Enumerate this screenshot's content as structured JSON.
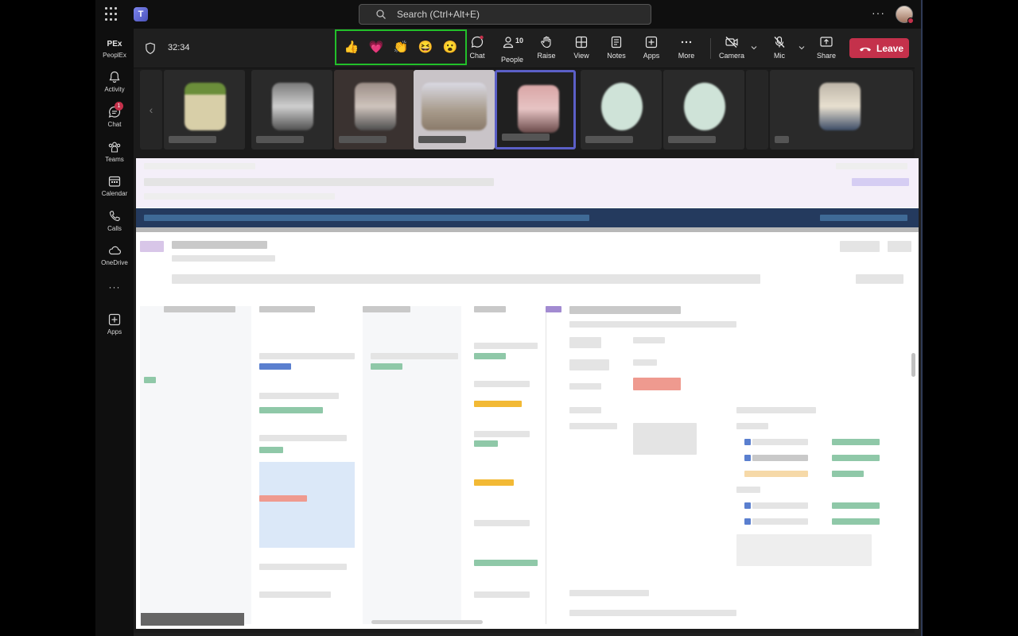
{
  "topbar": {
    "search_placeholder": "Search (Ctrl+Alt+E)",
    "more_label": "···"
  },
  "rail": {
    "org_label": "PEx",
    "items": [
      {
        "label": "PeoplEx"
      },
      {
        "label": "Activity"
      },
      {
        "label": "Chat",
        "badge": "1"
      },
      {
        "label": "Teams"
      },
      {
        "label": "Calendar"
      },
      {
        "label": "Calls"
      },
      {
        "label": "OneDrive"
      },
      {
        "label": "···"
      },
      {
        "label": "Apps"
      }
    ]
  },
  "meeting": {
    "timer": "32:34",
    "reactions": [
      "👍",
      "💗",
      "👏",
      "😆",
      "😮"
    ],
    "controls": {
      "chat": "Chat",
      "people": "People",
      "people_count": "10",
      "raise": "Raise",
      "view": "View",
      "notes": "Notes",
      "apps": "Apps",
      "more": "More",
      "camera": "Camera",
      "mic": "Mic",
      "share": "Share",
      "leave": "Leave"
    },
    "accent_color": "#5b5fc7",
    "leave_color": "#c4314b",
    "highlight_color": "#22c02a"
  }
}
